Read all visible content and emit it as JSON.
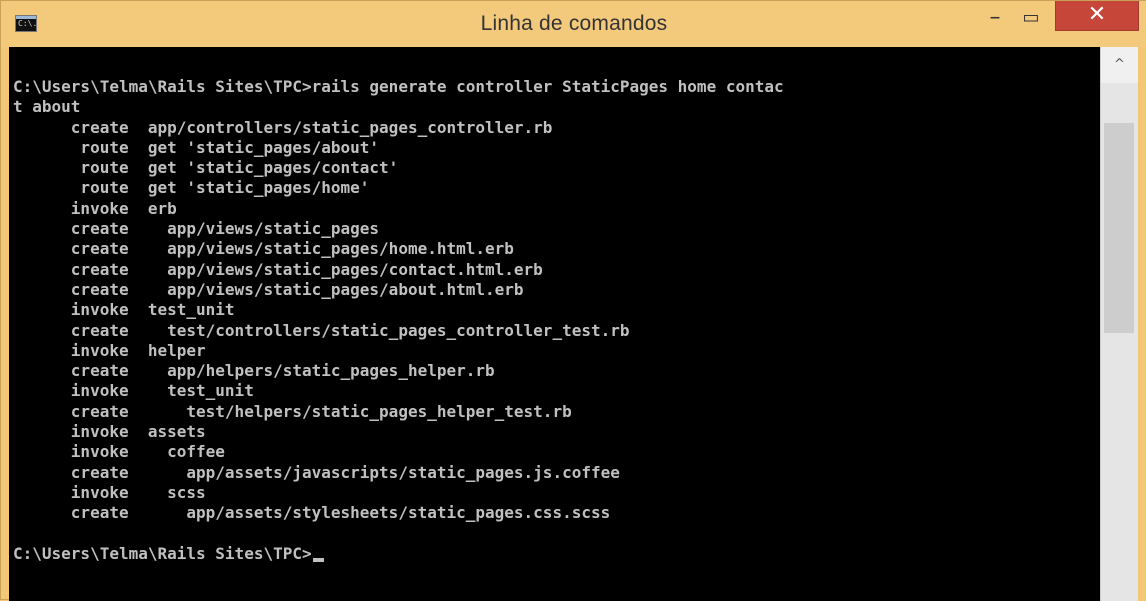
{
  "window": {
    "title": "Linha de comandos",
    "icon_text": "C:\\.",
    "controls": {
      "minimize": "–",
      "maximize": "▭",
      "close": "✕"
    }
  },
  "console": {
    "lines": [
      "C:\\Users\\Telma\\Rails Sites\\TPC>rails generate controller StaticPages home contac",
      "t about",
      "      create  app/controllers/static_pages_controller.rb",
      "       route  get 'static_pages/about'",
      "       route  get 'static_pages/contact'",
      "       route  get 'static_pages/home'",
      "      invoke  erb",
      "      create    app/views/static_pages",
      "      create    app/views/static_pages/home.html.erb",
      "      create    app/views/static_pages/contact.html.erb",
      "      create    app/views/static_pages/about.html.erb",
      "      invoke  test_unit",
      "      create    test/controllers/static_pages_controller_test.rb",
      "      invoke  helper",
      "      create    app/helpers/static_pages_helper.rb",
      "      invoke    test_unit",
      "      create      test/helpers/static_pages_helper_test.rb",
      "      invoke  assets",
      "      invoke    coffee",
      "      create      app/assets/javascripts/static_pages.js.coffee",
      "      invoke    scss",
      "      create      app/assets/stylesheets/static_pages.css.scss",
      "",
      "C:\\Users\\Telma\\Rails Sites\\TPC>"
    ]
  },
  "scrollbar": {
    "up_arrow": "^"
  },
  "colors": {
    "titlebar": "#f3c97c",
    "console_bg": "#000000",
    "console_text": "#c0c0c0",
    "close_button": "#c7463a"
  }
}
